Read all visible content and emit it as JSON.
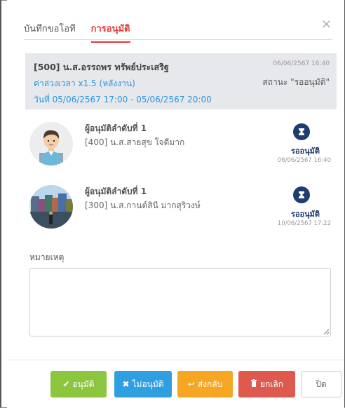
{
  "tabs": [
    {
      "label": "บันทึกขอโอที",
      "active": false
    },
    {
      "label": "การอนุมัติ",
      "active": true
    }
  ],
  "close_symbol": "×",
  "request": {
    "name": "[500] น.ส.อรรถพร ทรัพย์ประเสริฐ",
    "type": "ค่าล่วงเวลา x1.5 (หลังงาน)",
    "period": "วันที่ 05/06/2567 17:00 - 05/06/2567 20:00",
    "timestamp": "06/06/2567 16:40",
    "status": "สถานะ \"รออนุมัติ\""
  },
  "approvers": [
    {
      "title": "ผู้อนุมัติลำดับที่ 1",
      "name": "[400] น.ส.สายสุข ใจดีมาก",
      "status": "รออนุมัติ",
      "timestamp": "06/06/2567 16:40",
      "icon": "hourglass-icon"
    },
    {
      "title": "ผู้อนุมัติลำดับที่ 1",
      "name": "[300] น.ส.กานต์สินี มากสุริวงษ์",
      "status": "รออนุมัติ",
      "timestamp": "10/06/2567 17:22",
      "icon": "hourglass-icon"
    }
  ],
  "remark": {
    "label": "หมายเหตุ",
    "value": "",
    "placeholder": ""
  },
  "buttons": {
    "approve": "อนุมัติ",
    "reject": "ไม่อนุมัติ",
    "return": "ส่งกลับ",
    "cancel": "ยกเลิก",
    "close": "ปิด"
  },
  "colors": {
    "accent_red": "#e03a3a",
    "link_blue": "#2c97de",
    "status_navy": "#1e3d6e",
    "approve_green": "#8cc63f",
    "reject_blue": "#2f9fe0",
    "return_orange": "#f5a623",
    "cancel_red": "#de5a4e"
  }
}
